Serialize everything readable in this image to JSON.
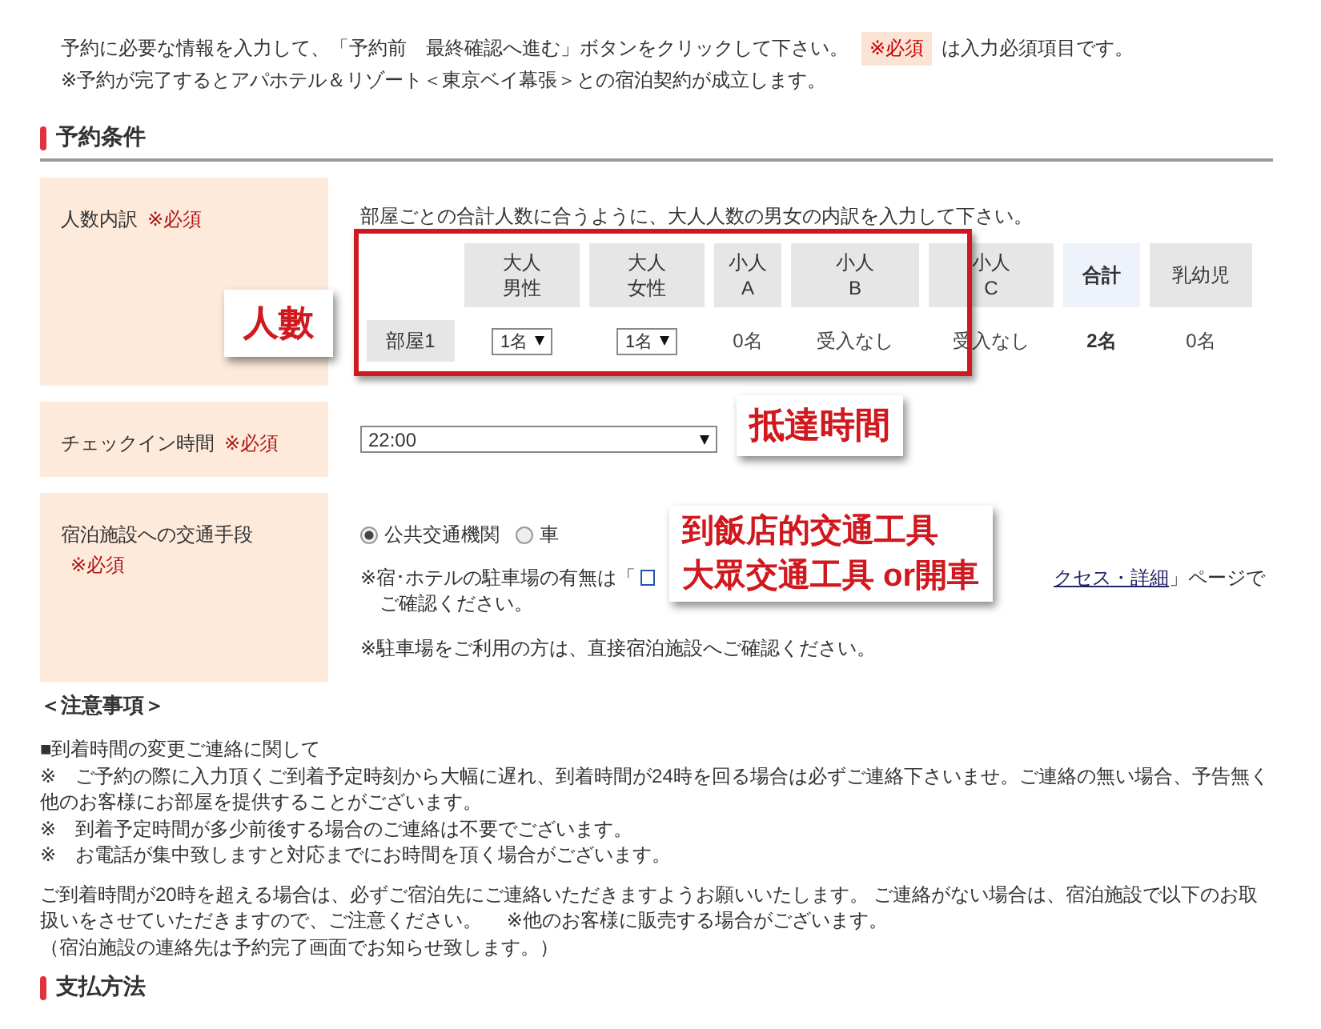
{
  "intro": {
    "before": "予約に必要な情報を入力して、「予約前　最終確認へ進む」ボタンをクリックして下さい。",
    "badge": "※必須",
    "after": "は入力必須項目です。",
    "line2": "※予約が完了するとアパホテル＆リゾート＜東京ベイ幕張＞との宿泊契約が成立します。"
  },
  "section": {
    "title": "予約条件"
  },
  "form_rows": [
    {
      "kind": "party",
      "label": "人数内訳",
      "required": "※必須",
      "description": "部屋ごとの合計人数に合うように、大人人数の男女の内訳を入力して下さい。",
      "columns": [
        {
          "kind": "blank"
        },
        {
          "kind": "head",
          "lines": [
            "大人",
            "男性"
          ]
        },
        {
          "kind": "head",
          "lines": [
            "大人",
            "女性"
          ]
        },
        {
          "kind": "head",
          "lines": [
            "小人",
            "A"
          ]
        },
        {
          "kind": "head",
          "lines": [
            "小人",
            "B"
          ]
        },
        {
          "kind": "head",
          "lines": [
            "小人",
            "C"
          ]
        },
        {
          "kind": "total",
          "lines": [
            "合計"
          ]
        },
        {
          "kind": "head",
          "lines": [
            "乳幼児"
          ]
        }
      ],
      "cells": [
        {
          "kind": "room",
          "text": "部屋1"
        },
        {
          "kind": "select",
          "text": "1名"
        },
        {
          "kind": "select",
          "text": "1名"
        },
        {
          "kind": "text",
          "text": "0名"
        },
        {
          "kind": "text",
          "text": "受入なし"
        },
        {
          "kind": "text",
          "text": "受入なし"
        },
        {
          "kind": "total",
          "text": "2名"
        },
        {
          "kind": "text",
          "text": "0名"
        }
      ]
    },
    {
      "kind": "select",
      "label": "チェックイン時間",
      "required": "※必須",
      "value": "22:00"
    },
    {
      "kind": "radio",
      "label": "宿泊施設への交通手段",
      "required": "※必須",
      "options": [
        {
          "label": "公共交通機関",
          "selected": true
        },
        {
          "label": "車",
          "selected": false
        }
      ],
      "parking_note": {
        "before": "※宿･ホテルの駐車場の有無は「",
        "link": "クセス・詳細",
        "after": "」ページで",
        "after_line2": "ご確認ください。"
      },
      "note2": "※駐車場をご利用の方は、直接宿泊施設へご確認ください。"
    }
  ],
  "notice": {
    "title": "＜注意事項＞",
    "lines": [
      "■到着時間の変更ご連絡に関して",
      "※　ご予約の際に入力頂くご到着予定時刻から大幅に遅れ、到着時間が24時を回る場合は必ずご連絡下さいませ。ご連絡の無い場合、予告無く他のお客様にお部屋を提供することがございます。",
      "※　到着予定時間が多少前後する場合のご連絡は不要でございます。",
      "※　お電話が集中致しますと対応までにお時間を頂く場合がございます。"
    ],
    "lines2": [
      "ご到着時間が20時を超える場合は、必ずご宿泊先にご連絡いただきますようお願いいたします。 ご連絡がない場合は、宿泊施設で以下のお取扱いをさせていただきますので、ご注意ください。　 ※他のお客様に販売する場合がございます。",
      "（宿泊施設の連絡先は予約完了画面でお知らせ致します。）"
    ]
  },
  "next_section": {
    "title": "支払方法"
  },
  "annotations": [
    {
      "kind": "party",
      "lines": [
        "人數"
      ]
    },
    {
      "kind": "time",
      "lines": [
        "抵達時間"
      ]
    },
    {
      "kind": "transport",
      "lines": [
        "到飯店的交通工具",
        "大眾交通工具 or開車"
      ]
    }
  ]
}
